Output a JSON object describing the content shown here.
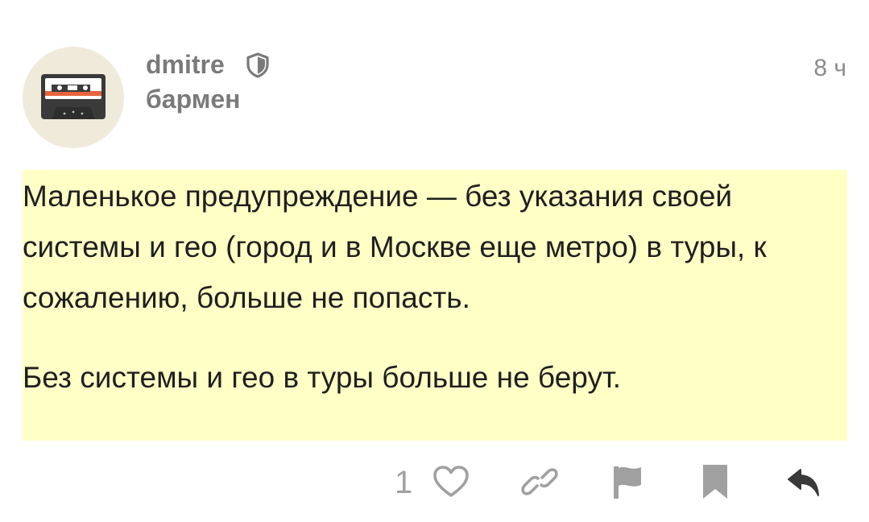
{
  "post": {
    "author": {
      "name": "dmitre",
      "role": "бармен",
      "avatar_icon": "cassette-tape-icon",
      "badge_icon": "shield-icon"
    },
    "timestamp": "8 ч",
    "highlight_color": "#ffffc6",
    "paragraphs": [
      "Маленькое предупреждение — без указания своей системы и гео (город и в Москве еще метро) в туры, к сожалению, больше не попасть.",
      "Без системы и гео в туры больше не берут."
    ]
  },
  "actions": {
    "like_count": "1",
    "icons": [
      "heart-icon",
      "link-icon",
      "flag-icon",
      "bookmark-icon",
      "reply-icon"
    ]
  }
}
